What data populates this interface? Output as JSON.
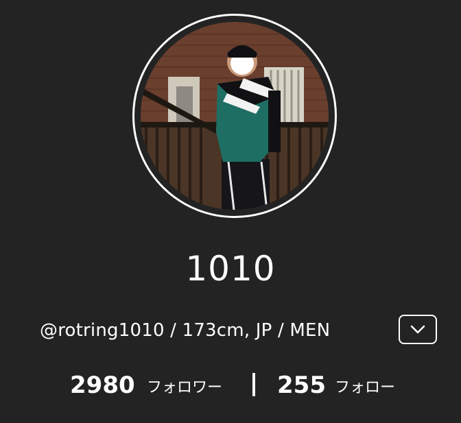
{
  "profile": {
    "display_name": "1010",
    "meta_line": "@rotring1010 / 173cm, JP / MEN",
    "followers_count": "2980",
    "followers_label": "フォロワー",
    "following_count": "255",
    "following_label": "フォロー"
  },
  "colors": {
    "background": "#232323",
    "text": "#ffffff"
  },
  "icons": {
    "expand": "chevron-down-icon"
  }
}
